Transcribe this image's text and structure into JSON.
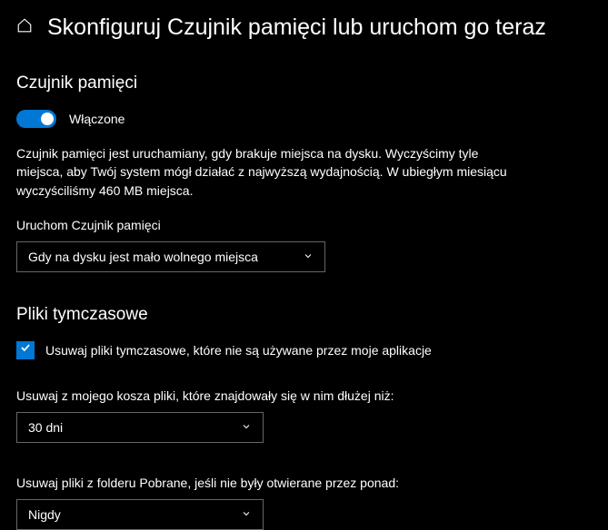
{
  "header": {
    "title": "Skonfiguruj Czujnik pamięci lub uruchom go teraz"
  },
  "storage_sense": {
    "section_title": "Czujnik pamięci",
    "toggle_label": "Włączone",
    "description": "Czujnik pamięci jest uruchamiany, gdy brakuje miejsca na dysku. Wyczyścimy tyle miejsca, aby Twój system mógł działać z najwyższą wydajnością. W ubiegłym miesiącu wyczyściliśmy 460 MB miejsca.",
    "run_label": "Uruchom Czujnik pamięci",
    "run_value": "Gdy na dysku jest mało wolnego miejsca"
  },
  "temp_files": {
    "section_title": "Pliki tymczasowe",
    "checkbox_label": "Usuwaj pliki tymczasowe, które nie są używane przez moje aplikacje",
    "recycle_label": "Usuwaj z mojego kosza pliki, które znajdowały się w nim dłużej niż:",
    "recycle_value": "30 dni",
    "downloads_label": "Usuwaj pliki z folderu Pobrane, jeśli nie były otwierane przez ponad:",
    "downloads_value": "Nigdy"
  }
}
